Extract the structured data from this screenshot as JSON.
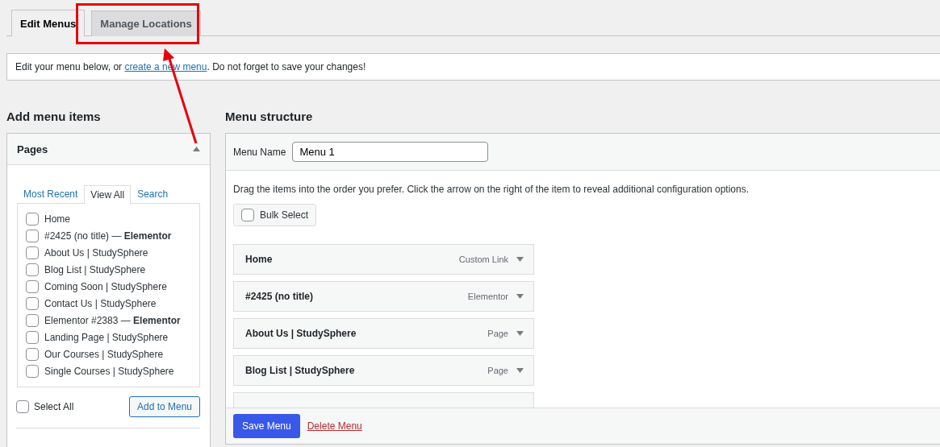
{
  "tabs": [
    {
      "label": "Edit Menus",
      "selected": true
    },
    {
      "label": "Manage Locations",
      "selected": false
    }
  ],
  "notice": {
    "text_before": "Edit your menu below, or ",
    "link": "create a new menu",
    "text_after": ". Do not forget to save your changes!"
  },
  "add_items": {
    "heading": "Add menu items",
    "box_title": "Pages",
    "expanded": true,
    "tabs": [
      {
        "label": "Most Recent",
        "selected": false
      },
      {
        "label": "View All",
        "selected": true
      },
      {
        "label": "Search",
        "selected": false
      }
    ],
    "pages": [
      {
        "label": "Home",
        "checked": false
      },
      {
        "label": "#2425 (no title) — **Elementor**",
        "checked": false
      },
      {
        "label": "About Us | StudySphere",
        "checked": false
      },
      {
        "label": "Blog List | StudySphere",
        "checked": false
      },
      {
        "label": "Coming Soon | StudySphere",
        "checked": false
      },
      {
        "label": "Contact Us | StudySphere",
        "checked": false
      },
      {
        "label": "Elementor #2383 — **Elementor**",
        "checked": false
      },
      {
        "label": "Landing Page | StudySphere",
        "checked": false
      },
      {
        "label": "Our Courses | StudySphere",
        "checked": false
      },
      {
        "label": "Single Courses | StudySphere",
        "checked": false
      }
    ],
    "select_all": {
      "label": "Select All",
      "checked": false
    },
    "add_button": "Add to Menu"
  },
  "structure": {
    "heading": "Menu structure",
    "name_label": "Menu Name",
    "name_value": "Menu 1",
    "instructions": "Drag the items into the order you prefer. Click the arrow on the right of the item to reveal additional configuration options.",
    "bulk_select": {
      "label": "Bulk Select",
      "checked": false
    },
    "items": [
      {
        "title": "Home",
        "type": "Custom Link"
      },
      {
        "title": "#2425 (no title)",
        "type": "Elementor"
      },
      {
        "title": "About Us | StudySphere",
        "type": "Page"
      },
      {
        "title": "Blog List | StudySphere",
        "type": "Page"
      },
      {
        "kind": "cut"
      }
    ],
    "save_button": "Save Menu",
    "delete_link": "Delete Menu"
  }
}
